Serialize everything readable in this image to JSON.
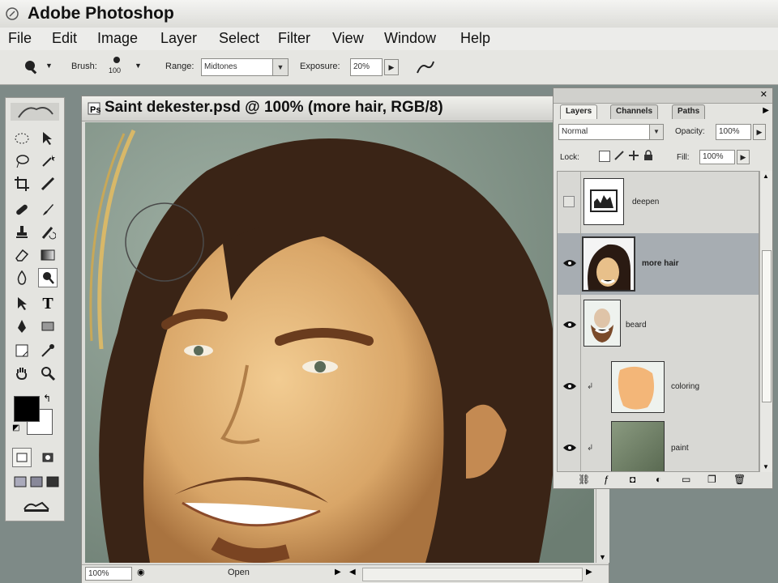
{
  "app": {
    "title": "Adobe Photoshop"
  },
  "menu": [
    "File",
    "Edit",
    "Image",
    "Layer",
    "Select",
    "Filter",
    "View",
    "Window",
    "Help"
  ],
  "options": {
    "brush_label": "Brush:",
    "brush_size": "100",
    "range_label": "Range:",
    "range_value": "Midtones",
    "exposure_label": "Exposure:",
    "exposure_value": "20%"
  },
  "document": {
    "title": "Saint dekester.psd @ 100% (more hair, RGB/8)",
    "zoom": "100%",
    "status": "Open"
  },
  "layers_panel": {
    "tabs": [
      "Layers",
      "Channels",
      "Paths"
    ],
    "blend_mode": "Normal",
    "opacity_label": "Opacity:",
    "opacity_value": "100%",
    "lock_label": "Lock:",
    "fill_label": "Fill:",
    "fill_value": "100%",
    "layers": [
      {
        "name": "deepen",
        "visible": false,
        "selected": false
      },
      {
        "name": "more hair",
        "visible": true,
        "selected": true
      },
      {
        "name": "beard",
        "visible": true,
        "selected": false
      },
      {
        "name": "coloring",
        "visible": true,
        "selected": false
      },
      {
        "name": "paint",
        "visible": true,
        "selected": false
      }
    ]
  },
  "colors": {
    "selected_layer": "#a7adb2",
    "coloring_swatch": "#f3b678",
    "paint_swatch": "#6f806a"
  }
}
